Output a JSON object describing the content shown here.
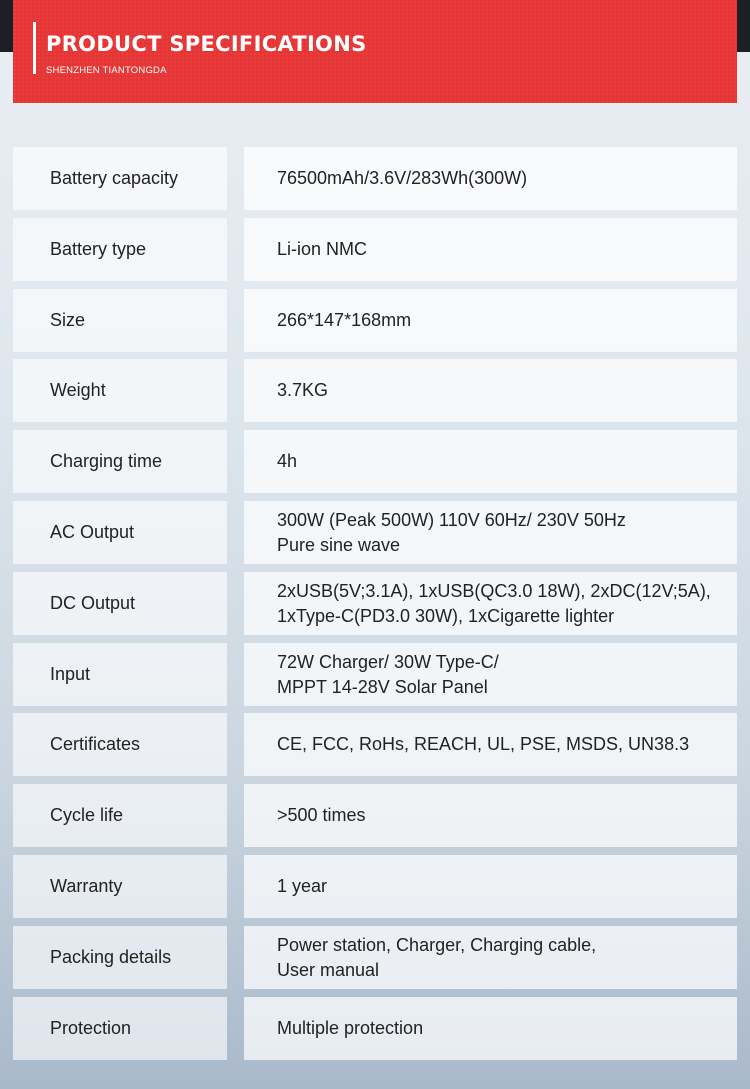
{
  "header": {
    "title": "PRODUCT SPECIFICATIONS",
    "subtitle": "SHENZHEN TIANTONGDA"
  },
  "specs": [
    {
      "label": "Battery capacity",
      "lines": [
        "76500mAh/3.6V/283Wh(300W)"
      ]
    },
    {
      "label": "Battery type",
      "lines": [
        "Li-ion NMC"
      ]
    },
    {
      "label": "Size",
      "lines": [
        "266*147*168mm"
      ]
    },
    {
      "label": "Weight",
      "lines": [
        "3.7KG"
      ]
    },
    {
      "label": "Charging time",
      "lines": [
        "4h"
      ]
    },
    {
      "label": "AC Output",
      "lines": [
        "300W (Peak 500W)  110V 60Hz/ 230V 50Hz",
        "Pure sine wave"
      ]
    },
    {
      "label": "DC Output",
      "lines": [
        "2xUSB(5V;3.1A), 1xUSB(QC3.0 18W), 2xDC(12V;5A),",
        "1xType-C(PD3.0 30W), 1xCigarette lighter"
      ]
    },
    {
      "label": "Input",
      "lines": [
        "72W Charger/ 30W Type-C/",
        "MPPT 14-28V Solar Panel"
      ]
    },
    {
      "label": "Certificates",
      "lines": [
        "CE, FCC, RoHs, REACH, UL, PSE, MSDS, UN38.3"
      ]
    },
    {
      "label": "Cycle life",
      "lines": [
        ">500 times"
      ]
    },
    {
      "label": "Warranty",
      "lines": [
        "1 year"
      ]
    },
    {
      "label": "Packing details",
      "lines": [
        "Power station, Charger, Charging cable,",
        "User manual"
      ]
    },
    {
      "label": "Protection",
      "lines": [
        "Multiple protection"
      ]
    }
  ]
}
